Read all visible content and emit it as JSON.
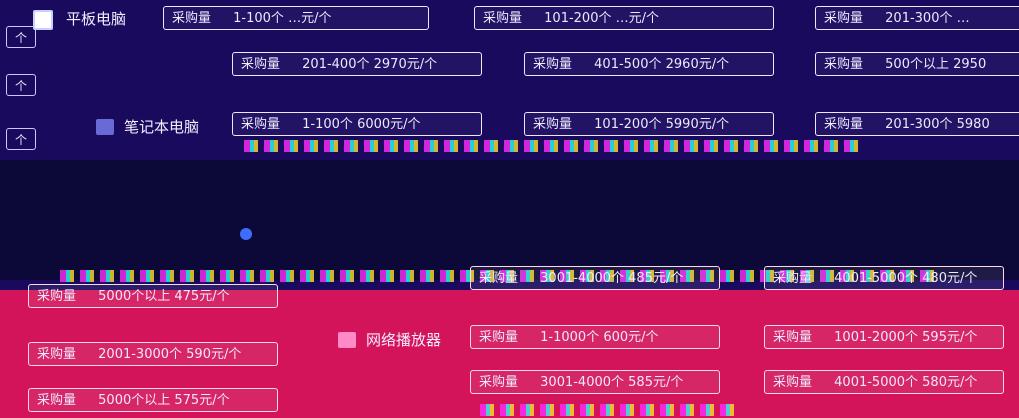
{
  "side_units": [
    "个",
    "个",
    "个"
  ],
  "categories": [
    {
      "id": "flat",
      "name": "平板电脑",
      "checkbox": true
    },
    {
      "id": "laptop",
      "name": "笔记本电脑"
    },
    {
      "id": "mp3",
      "name": "网络播放器"
    }
  ],
  "rows": {
    "flat_row1": [
      {
        "qty_label": "采购量",
        "range": "1-100个",
        "price": "…元/个"
      },
      {
        "qty_label": "采购量",
        "range": "101-200个",
        "price": "…元/个"
      },
      {
        "qty_label": "采购量",
        "range": "201-300个",
        "price": "…"
      }
    ],
    "flat_row2": [
      {
        "qty_label": "采购量",
        "range": "201-400个",
        "price": "2970元/个"
      },
      {
        "qty_label": "采购量",
        "range": "401-500个",
        "price": "2960元/个"
      },
      {
        "qty_label": "采购量",
        "range": "500个以上",
        "price": "2950"
      }
    ],
    "laptop_row1": [
      {
        "qty_label": "采购量",
        "range": "1-100个",
        "price": "6000元/个"
      },
      {
        "qty_label": "采购量",
        "range": "101-200个",
        "price": "5990元/个"
      },
      {
        "qty_label": "采购量",
        "range": "201-300个",
        "price": "5980"
      }
    ],
    "left_pink": [
      {
        "qty_label": "采购量",
        "range": "5000个以上",
        "price": "475元/个"
      },
      {
        "qty_label": "采购量",
        "range": "2001-3000个",
        "price": "590元/个"
      },
      {
        "qty_label": "采购量",
        "range": "5000个以上",
        "price": "575元/个"
      }
    ],
    "mp3_row1": [
      {
        "qty_label": "采购量",
        "range": "3001-4000个",
        "price": "485元/个"
      },
      {
        "qty_label": "采购量",
        "range": "4001-5000个",
        "price": "480元/个"
      }
    ],
    "mp3_row2": [
      {
        "qty_label": "采购量",
        "range": "1-1000个",
        "price": "600元/个"
      },
      {
        "qty_label": "采购量",
        "range": "1001-2000个",
        "price": "595元/个"
      }
    ],
    "mp3_row3": [
      {
        "qty_label": "采购量",
        "range": "3001-4000个",
        "price": "585元/个"
      },
      {
        "qty_label": "采购量",
        "range": "4001-5000个",
        "price": "580元/个"
      }
    ]
  }
}
